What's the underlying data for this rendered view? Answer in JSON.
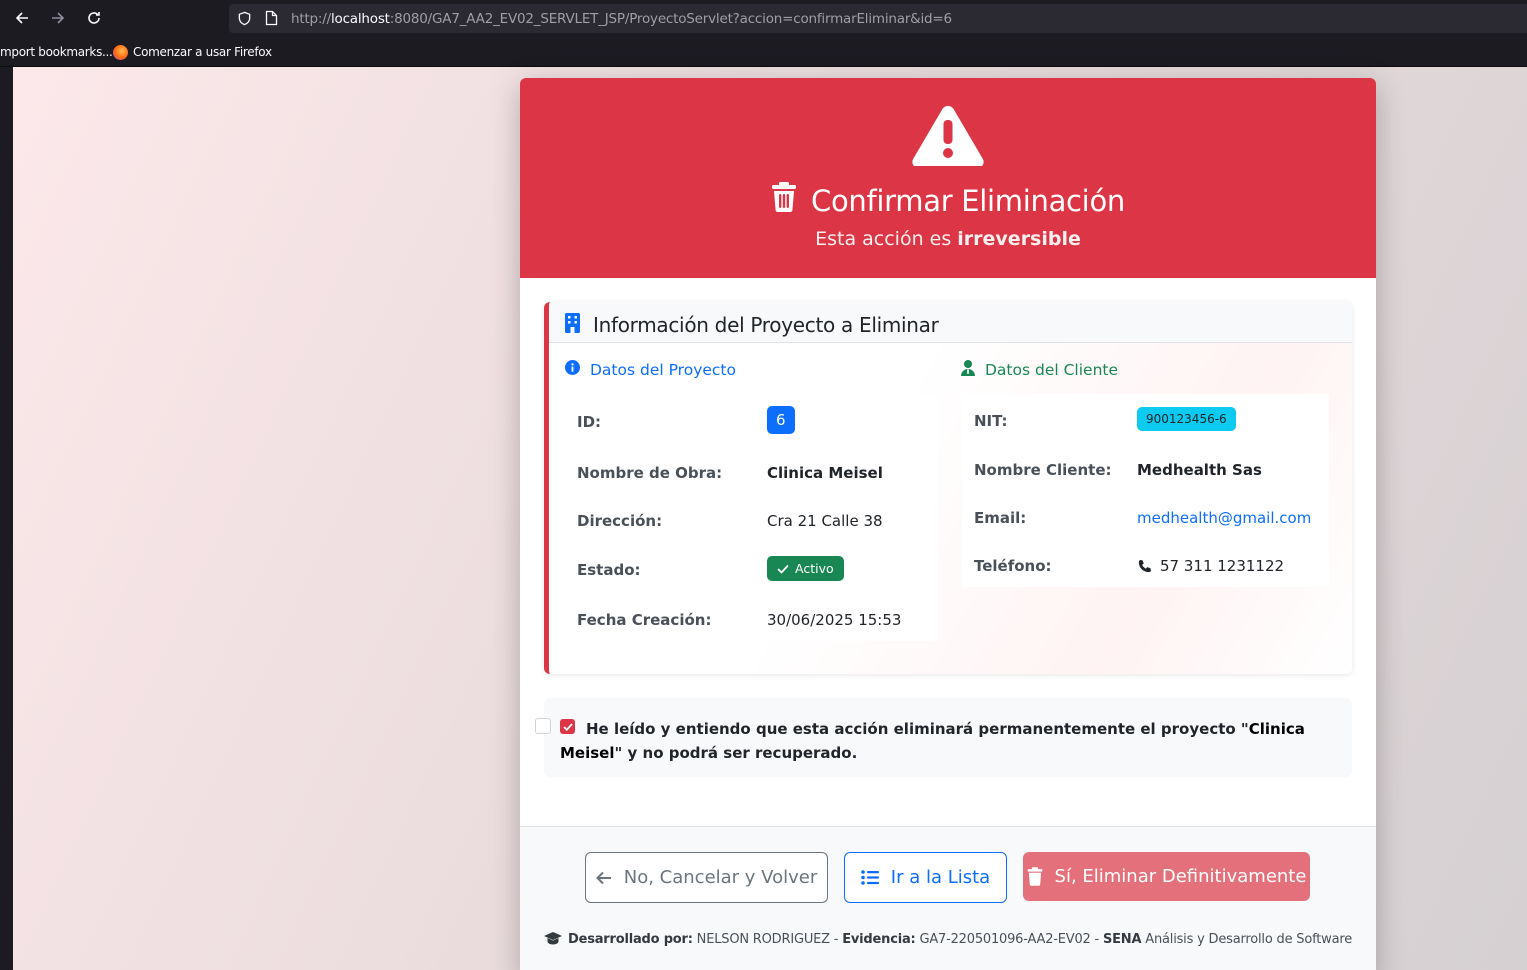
{
  "browser": {
    "url_host": "localhost",
    "url_rest": ":8080/GA7_AA2_EV02_SERVLET_JSP/ProyectoServlet?accion=confirmarEliminar&id=6",
    "url_scheme": "http://",
    "bookmarks": [
      "mport bookmarks...",
      "Comenzar a usar Firefox"
    ]
  },
  "header": {
    "title": "Confirmar Eliminación",
    "subtitle_prefix": "Esta acción es ",
    "subtitle_strong": "irreversible"
  },
  "info_card": {
    "title": "Información del Proyecto a Eliminar",
    "project": {
      "section_title": "Datos del Proyecto",
      "id_label": "ID:",
      "id_value": "6",
      "name_label": "Nombre de Obra:",
      "name_value": "Clinica Meisel",
      "address_label": "Dirección:",
      "address_value": "Cra 21 Calle 38",
      "status_label": "Estado:",
      "status_value": "Activo",
      "date_label": "Fecha Creación:",
      "date_value": "30/06/2025 15:53"
    },
    "client": {
      "section_title": "Datos del Cliente",
      "nit_label": "NIT:",
      "nit_value": "900123456-6",
      "name_label": "Nombre Cliente:",
      "name_value": "Medhealth Sas",
      "email_label": "Email:",
      "email_value": "medhealth@gmail.com",
      "phone_label": "Teléfono:",
      "phone_value": "57 311 1231122"
    }
  },
  "confirmation": {
    "text_before": "He leído y entiendo que esta acción eliminará permanentemente el proyecto \"",
    "project_name": "Clinica Meisel",
    "text_after": "\" y no podrá ser recuperado."
  },
  "actions": {
    "cancel_label": "No, Cancelar y Volver",
    "list_label": "Ir a la Lista",
    "delete_label": "Sí, Eliminar Definitivamente"
  },
  "credits": {
    "dev_label": "Desarrollado por:",
    "dev_value": " NELSON RODRIGUEZ - ",
    "evidence_label": "Evidencia:",
    "evidence_value": " GA7-220501096-AA2-EV02 - ",
    "org": "SENA",
    "program": " Análisis y Desarrollo de Software"
  },
  "colors": {
    "danger": "#dc3545",
    "primary": "#0d6efd",
    "success": "#198754",
    "info": "#0dcaf0",
    "secondary": "#6c757d"
  }
}
